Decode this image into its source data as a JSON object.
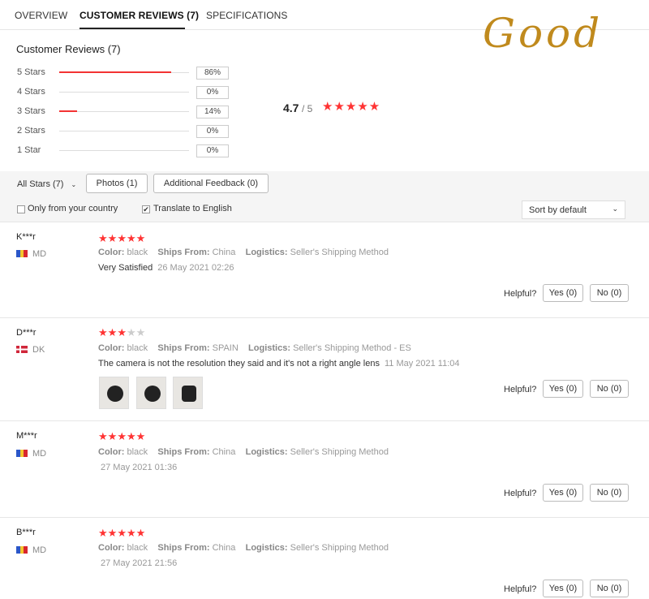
{
  "tabs": [
    {
      "label": "OVERVIEW"
    },
    {
      "label": "CUSTOMER REVIEWS (7)"
    },
    {
      "label": "SPECIFICATIONS"
    }
  ],
  "watermark": "Good",
  "summary": {
    "title": "Customer Reviews (7)",
    "bars": [
      {
        "label": "5 Stars",
        "pct": "86%",
        "value": 0.86
      },
      {
        "label": "4 Stars",
        "pct": "0%",
        "value": 0
      },
      {
        "label": "3 Stars",
        "pct": "14%",
        "value": 0.14
      },
      {
        "label": "2 Stars",
        "pct": "0%",
        "value": 0
      },
      {
        "label": "1 Star",
        "pct": "0%",
        "value": 0
      }
    ],
    "average": "4.7",
    "out_of": "/ 5",
    "average_stars": "★★★★★",
    "accent_color": "#f33333"
  },
  "filter": {
    "all_stars": "All Stars (7)",
    "photos": "Photos (1)",
    "additional": "Additional Feedback (0)",
    "only_country": "Only from your country",
    "translate": "Translate to English",
    "translate_checked": "✔",
    "sort": "Sort by default"
  },
  "labels": {
    "color": "Color:",
    "ships_from": "Ships From:",
    "logistics": "Logistics:",
    "helpful": "Helpful?"
  },
  "reviews": [
    {
      "name": "K***r",
      "country": "MD",
      "rating": 5,
      "color": "black",
      "ships_from": "China",
      "logistics": "Seller's Shipping Method",
      "text": "Very Satisfied",
      "date": "26 May 2021 02:26",
      "yes": "Yes (0)",
      "no": "No (0)"
    },
    {
      "name": "D***r",
      "country": "DK",
      "rating": 3,
      "color": "black",
      "ships_from": "SPAIN",
      "logistics": "Seller's Shipping Method - ES",
      "text": "The camera is not the resolution they said and it's not a right angle lens",
      "date": "11 May 2021 11:04",
      "yes": "Yes (0)",
      "no": "No (0)"
    },
    {
      "name": "M***r",
      "country": "MD",
      "rating": 5,
      "color": "black",
      "ships_from": "China",
      "logistics": "Seller's Shipping Method",
      "text": "",
      "date": "27 May 2021 01:36",
      "yes": "Yes (0)",
      "no": "No (0)"
    },
    {
      "name": "B***r",
      "country": "MD",
      "rating": 5,
      "color": "black",
      "ships_from": "China",
      "logistics": "Seller's Shipping Method",
      "text": "",
      "date": "27 May 2021 21:56",
      "yes": "Yes (0)",
      "no": "No (0)"
    }
  ]
}
